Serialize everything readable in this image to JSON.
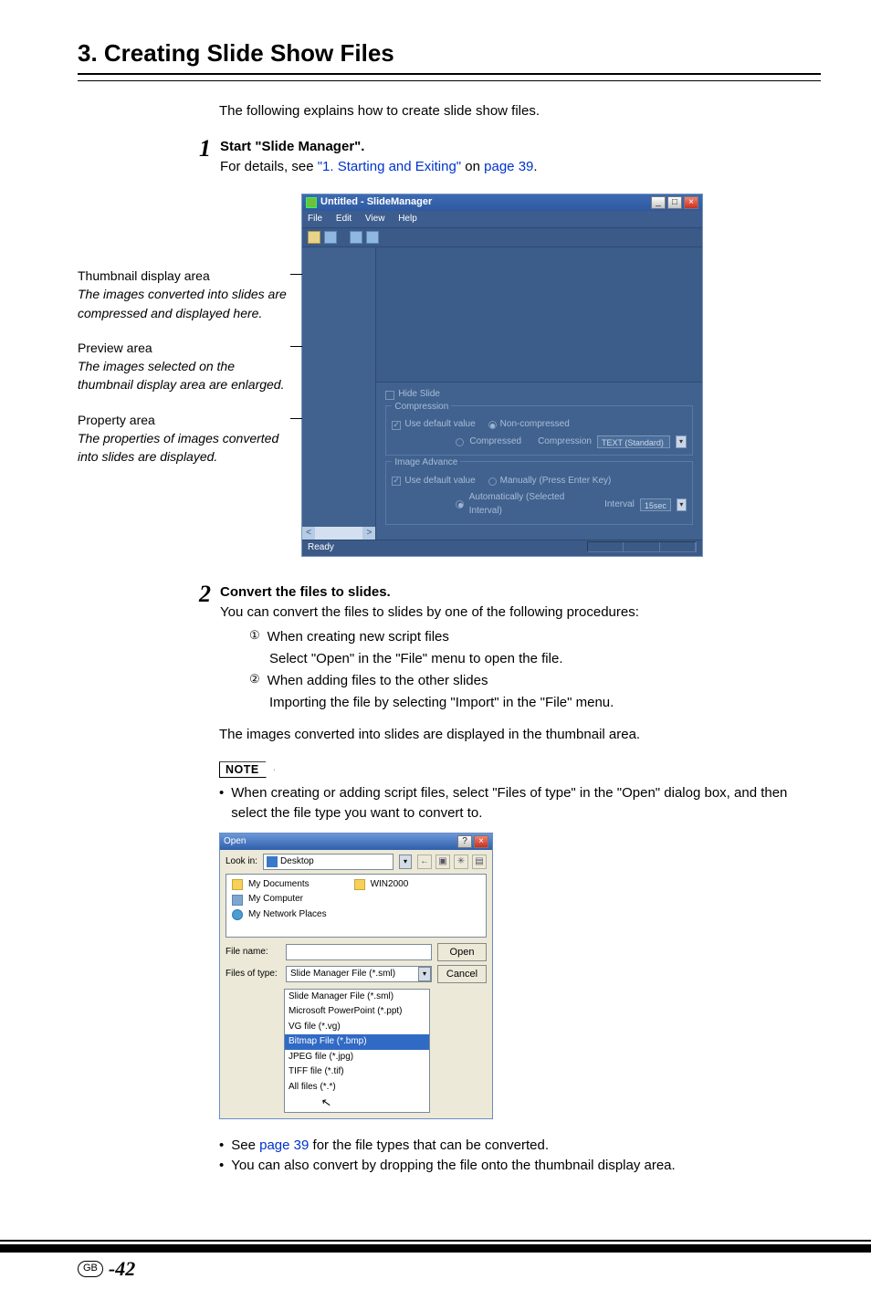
{
  "section_title": "3. Creating Slide Show Files",
  "intro": "The following explains how to create slide show files.",
  "steps": {
    "s1": {
      "num": "1",
      "title": "Start \"Slide Manager\".",
      "desc_prefix": "For details, see ",
      "link1": "\"1. Starting and Exiting\"",
      "mid": " on ",
      "link2": "page 39",
      "suffix": "."
    },
    "s2": {
      "num": "2",
      "title": "Convert the files to slides.",
      "desc": "You can convert the files to slides by one of the following procedures:",
      "item1_num": "①",
      "item1_a": "When creating new script files",
      "item1_b": "Select \"Open\" in the \"File\" menu to open the file.",
      "item2_num": "②",
      "item2_a": "When adding files to the other slides",
      "item2_b": "Importing the file by selecting \"Import\" in the \"File\" menu."
    }
  },
  "callouts": {
    "thumb_title": "Thumbnail display area",
    "thumb_desc": "The images converted into slides are compressed and displayed here.",
    "preview_title": "Preview area",
    "preview_desc": "The images selected on the thumbnail display area are enlarged.",
    "prop_title": "Property area",
    "prop_desc": "The properties of images converted into slides are displayed."
  },
  "app": {
    "title": "Untitled - SlideManager",
    "menu": {
      "file": "File",
      "edit": "Edit",
      "view": "View",
      "help": "Help"
    },
    "hide_slide": "Hide Slide",
    "compression": {
      "legend": "Compression",
      "use_default": "Use default value",
      "non_compressed": "Non-compressed",
      "compressed": "Compressed",
      "label": "Compression",
      "value": "TEXT (Standard)"
    },
    "advance": {
      "legend": "Image Advance",
      "use_default": "Use default value",
      "manual": "Manually (Press Enter Key)",
      "auto": "Automatically (Selected Interval)",
      "interval_label": "Interval",
      "interval_value": "15sec"
    },
    "status": "Ready"
  },
  "thumb_area_note": "The images converted into slides are displayed in the thumbnail area.",
  "note_label": "NOTE",
  "note_bullet": "When creating or adding script files, select \"Files of type\" in the \"Open\" dialog box, and then select the file type you want to convert to.",
  "open_dialog": {
    "title": "Open",
    "look_in": "Look in:",
    "look_value": "Desktop",
    "items": {
      "docs": "My Documents",
      "win": "WIN2000",
      "comp": "My Computer",
      "net": "My Network Places"
    },
    "file_name_label": "File name:",
    "file_type_label": "Files of type:",
    "file_type_value": "Slide Manager File (*.sml)",
    "open_btn": "Open",
    "cancel_btn": "Cancel",
    "dd": {
      "i1": "Slide Manager File (*.sml)",
      "i2": "Microsoft PowerPoint (*.ppt)",
      "i3": "VG file (*.vg)",
      "i4": "Bitmap File (*.bmp)",
      "i5": "JPEG file (*.jpg)",
      "i6": "TIFF file (*.tif)",
      "i7": "All files (*.*)"
    }
  },
  "post_bullets": {
    "b1_a": "See ",
    "b1_link": "page 39",
    "b1_b": " for the file types that can be converted.",
    "b2": "You can also convert by dropping the file onto the thumbnail display area."
  },
  "footer": {
    "region": "GB",
    "page": "-42"
  }
}
